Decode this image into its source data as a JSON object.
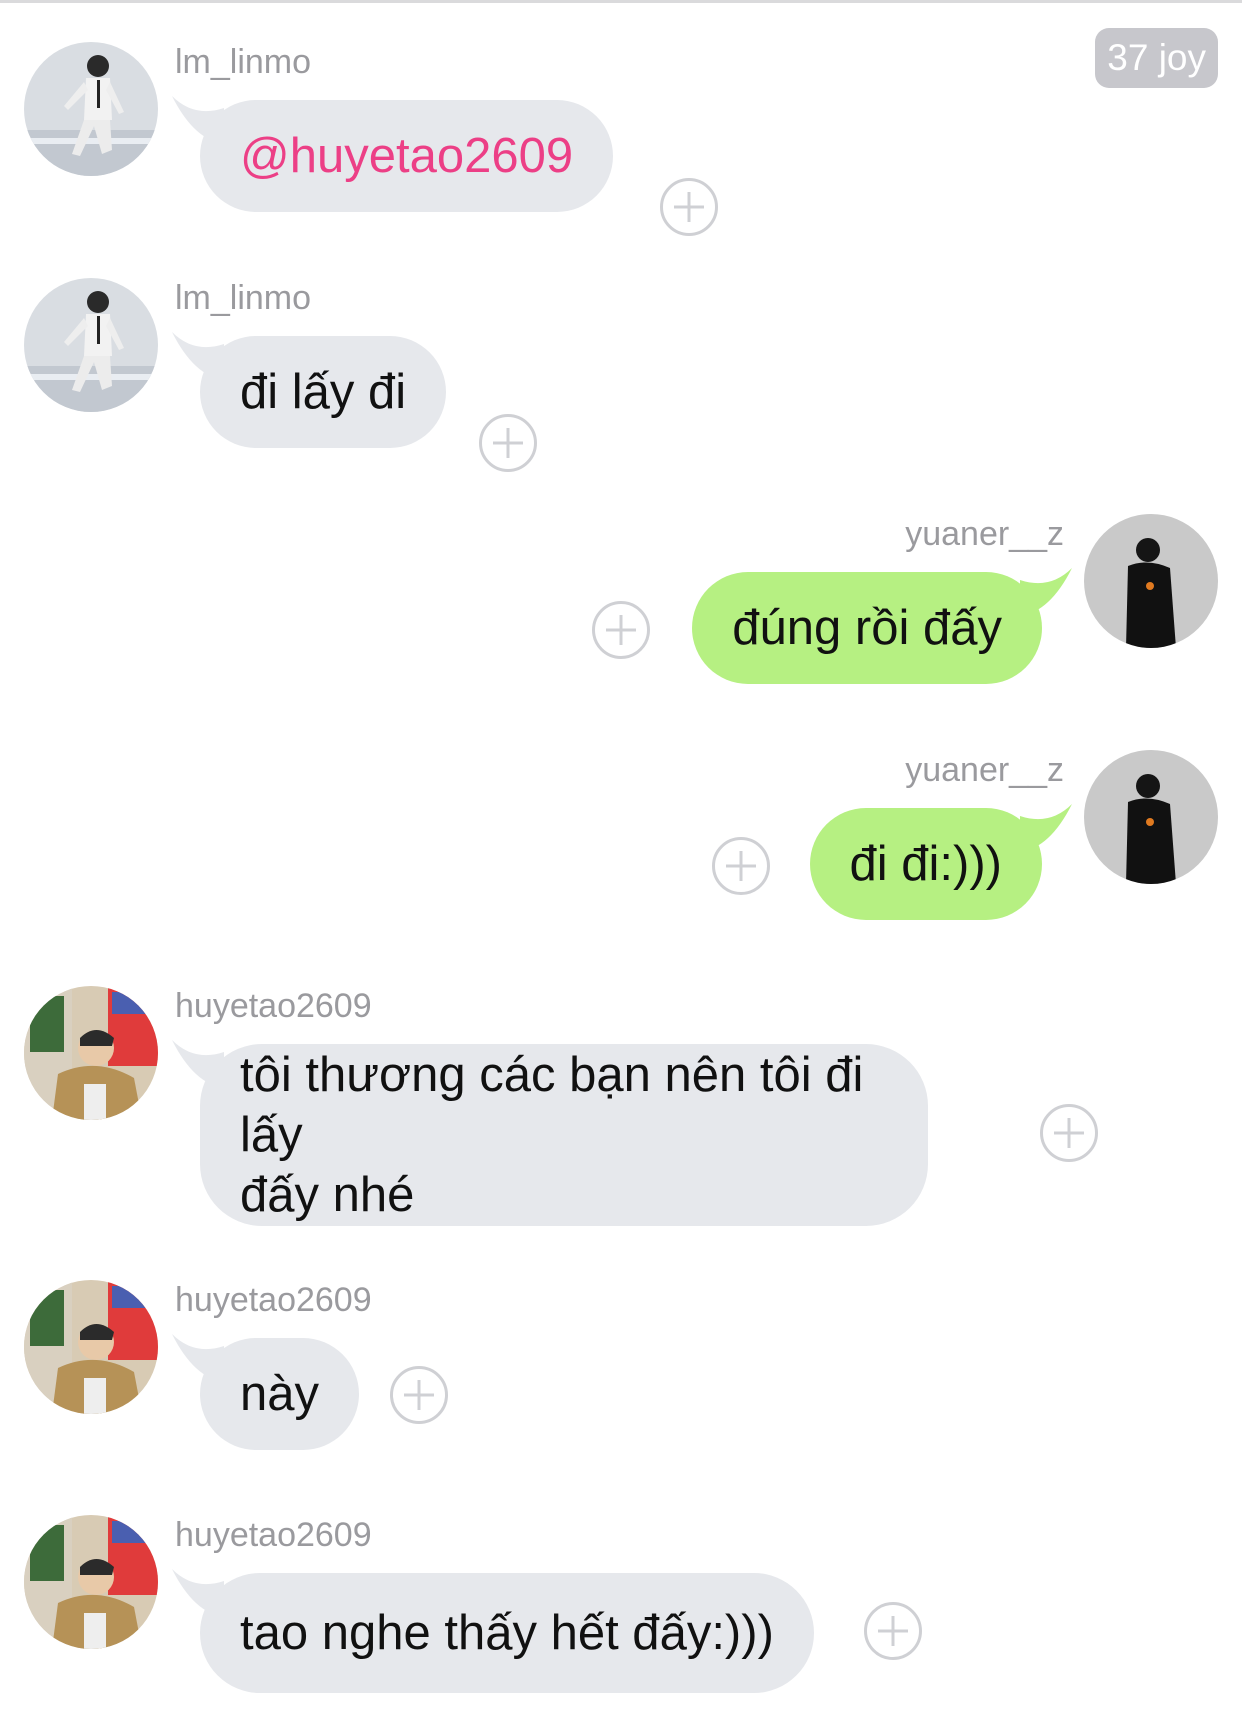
{
  "badge": "37 joy",
  "messages": [
    {
      "user": "lm_linmo",
      "text": "@huyetao2609",
      "avatar": "figure-skater-avatar"
    },
    {
      "user": "lm_linmo",
      "text": "đi lấy đi",
      "avatar": "figure-skater-avatar"
    },
    {
      "user": "yuaner__z",
      "text": "đúng rồi đấy",
      "avatar": "dark-portrait-avatar"
    },
    {
      "user": "yuaner__z",
      "text": "đi đi:)))",
      "avatar": "dark-portrait-avatar"
    },
    {
      "user": "huyetao2609",
      "text_line1": "tôi thương các bạn nên tôi đi lấy",
      "text_line2": "đấy nhé",
      "avatar": "arcade-photo-avatar"
    },
    {
      "user": "huyetao2609",
      "text": "này",
      "avatar": "arcade-photo-avatar"
    },
    {
      "user": "huyetao2609",
      "text": "tao nghe thấy hết đấy:)))",
      "avatar": "arcade-photo-avatar"
    }
  ],
  "colors": {
    "incoming_bubble": "#e6e8ec",
    "outgoing_bubble": "#b6f082",
    "mention": "#ec3f86",
    "username": "#9a9a9e"
  },
  "icons": {
    "react": "plus-circle-icon"
  }
}
